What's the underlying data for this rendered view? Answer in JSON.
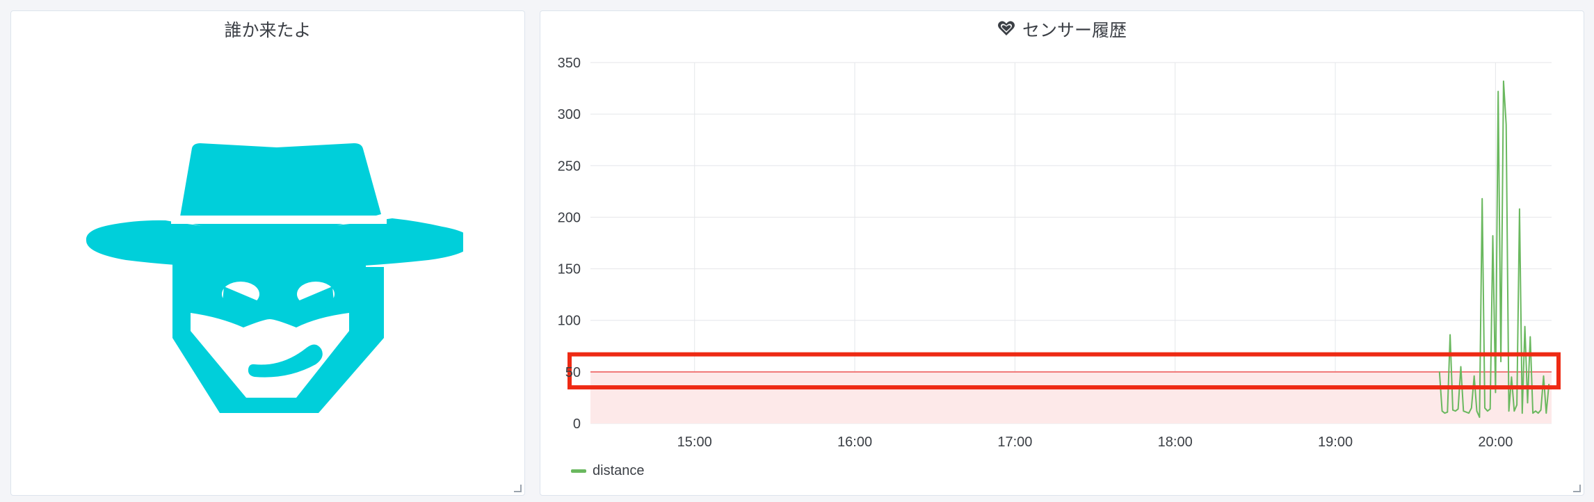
{
  "left_panel": {
    "title": "誰か来たよ",
    "image_icon": "masked-thief-icon",
    "image_color": "#00cfda"
  },
  "right_panel": {
    "title": "センサー履歴",
    "title_icon": "heart-icon"
  },
  "chart_data": {
    "type": "line",
    "title": "センサー履歴",
    "x_tick_labels": [
      "15:00",
      "16:00",
      "17:00",
      "18:00",
      "19:00",
      "20:00"
    ],
    "y_tick_labels": [
      "0",
      "50",
      "100",
      "150",
      "200",
      "250",
      "300",
      "350"
    ],
    "ylim": [
      0,
      350
    ],
    "xlim": [
      "14:21",
      "20:21"
    ],
    "grid": true,
    "legend_position": "bottom-left",
    "threshold": {
      "value": 50,
      "fill": "below",
      "line_color": "#f07474",
      "fill_color": "#fde9e9"
    },
    "annotation": {
      "type": "highlight-box",
      "color": "#ee2a14",
      "y_range": [
        35,
        67
      ]
    },
    "series": [
      {
        "name": "distance",
        "color": "#6ab85f",
        "x": [
          "19:39",
          "19:40",
          "19:41",
          "19:42",
          "19:43",
          "19:44",
          "19:45",
          "19:46",
          "19:47",
          "19:48",
          "19:49",
          "19:50",
          "19:51",
          "19:52",
          "19:53",
          "19:54",
          "19:55",
          "19:56",
          "19:57",
          "19:58",
          "19:59",
          "20:00",
          "20:01",
          "20:02",
          "20:03",
          "20:04",
          "20:05",
          "20:06",
          "20:07",
          "20:08",
          "20:09",
          "20:10",
          "20:11",
          "20:12",
          "20:13",
          "20:14",
          "20:15",
          "20:16",
          "20:17",
          "20:18",
          "20:19",
          "20:20"
        ],
        "values": [
          50,
          12,
          10,
          11,
          86,
          13,
          12,
          14,
          55,
          12,
          11,
          10,
          15,
          46,
          12,
          6,
          218,
          15,
          12,
          14,
          182,
          30,
          322,
          60,
          332,
          290,
          12,
          45,
          12,
          18,
          208,
          10,
          94,
          20,
          84,
          10,
          12,
          10,
          13,
          46,
          10,
          38
        ]
      }
    ]
  }
}
